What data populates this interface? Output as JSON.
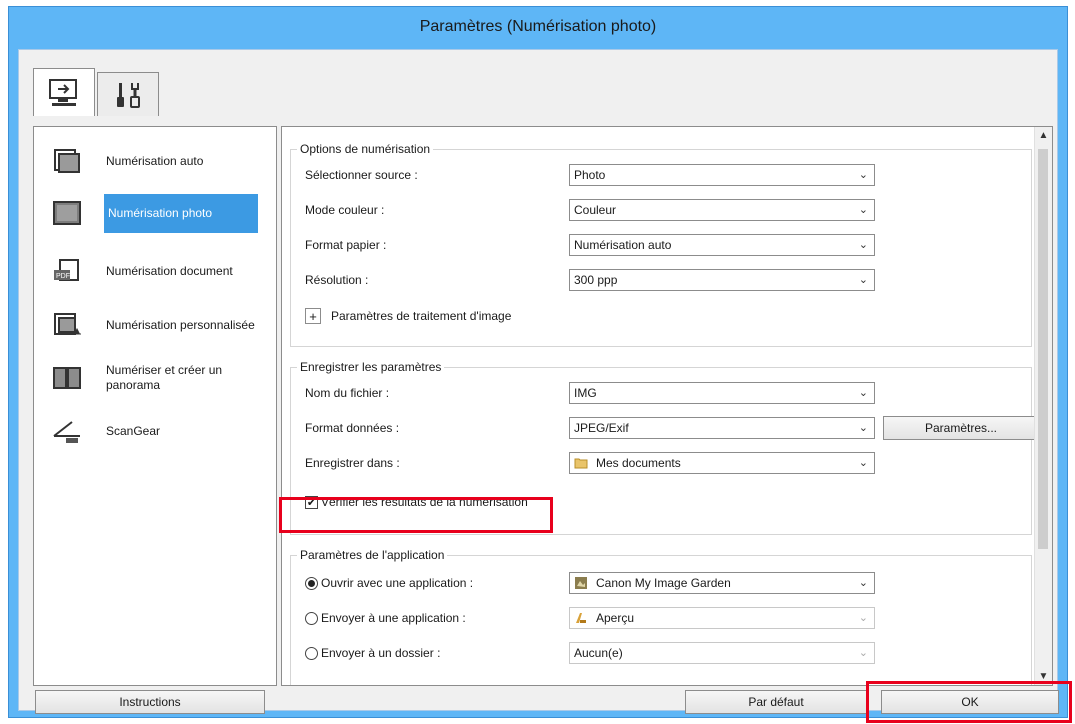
{
  "window": {
    "title": "Paramètres (Numérisation photo)"
  },
  "tabs": [
    {
      "name": "scan-settings-tab"
    },
    {
      "name": "general-settings-tab"
    }
  ],
  "nav": {
    "items": [
      {
        "label": "Numérisation auto",
        "icon": "auto-scan-icon"
      },
      {
        "label": "Numérisation photo",
        "icon": "photo-scan-icon",
        "selected": true
      },
      {
        "label": "Numérisation document",
        "icon": "document-scan-icon"
      },
      {
        "label": "Numérisation personnalisée",
        "icon": "custom-scan-icon"
      },
      {
        "label": "Numériser et créer un panorama",
        "icon": "panorama-icon"
      },
      {
        "label": "ScanGear",
        "icon": "scangear-icon"
      }
    ]
  },
  "scan_options": {
    "legend": "Options de numérisation",
    "source_label": "Sélectionner source :",
    "source_value": "Photo",
    "color_label": "Mode couleur :",
    "color_value": "Couleur",
    "paper_label": "Format papier :",
    "paper_value": "Numérisation auto",
    "resolution_label": "Résolution :",
    "resolution_value": "300 ppp",
    "image_processing_label": "Paramètres de traitement d'image"
  },
  "save_settings": {
    "legend": "Enregistrer les paramètres",
    "filename_label": "Nom du fichier :",
    "filename_value": "IMG",
    "format_label": "Format données :",
    "format_value": "JPEG/Exif",
    "format_settings_button": "Paramètres...",
    "savein_label": "Enregistrer dans :",
    "savein_value": "Mes documents",
    "check_results_label": "Vérifier les résultats de la numérisation",
    "check_results_checked": true
  },
  "app_settings": {
    "legend": "Paramètres de l'application",
    "open_app_label": "Ouvrir avec une application :",
    "open_app_value": "Canon My Image Garden",
    "send_app_label": "Envoyer à une application :",
    "send_app_value": "Aperçu",
    "send_folder_label": "Envoyer à un dossier :",
    "send_folder_value": "Aucun(e)",
    "selected_option": "open_app"
  },
  "footer": {
    "instructions_button": "Instructions",
    "default_button": "Par défaut",
    "ok_button": "OK"
  },
  "colors": {
    "title_bar": "#5eb6f6",
    "selection": "#3c9ae3",
    "highlight": "#e8001c"
  }
}
